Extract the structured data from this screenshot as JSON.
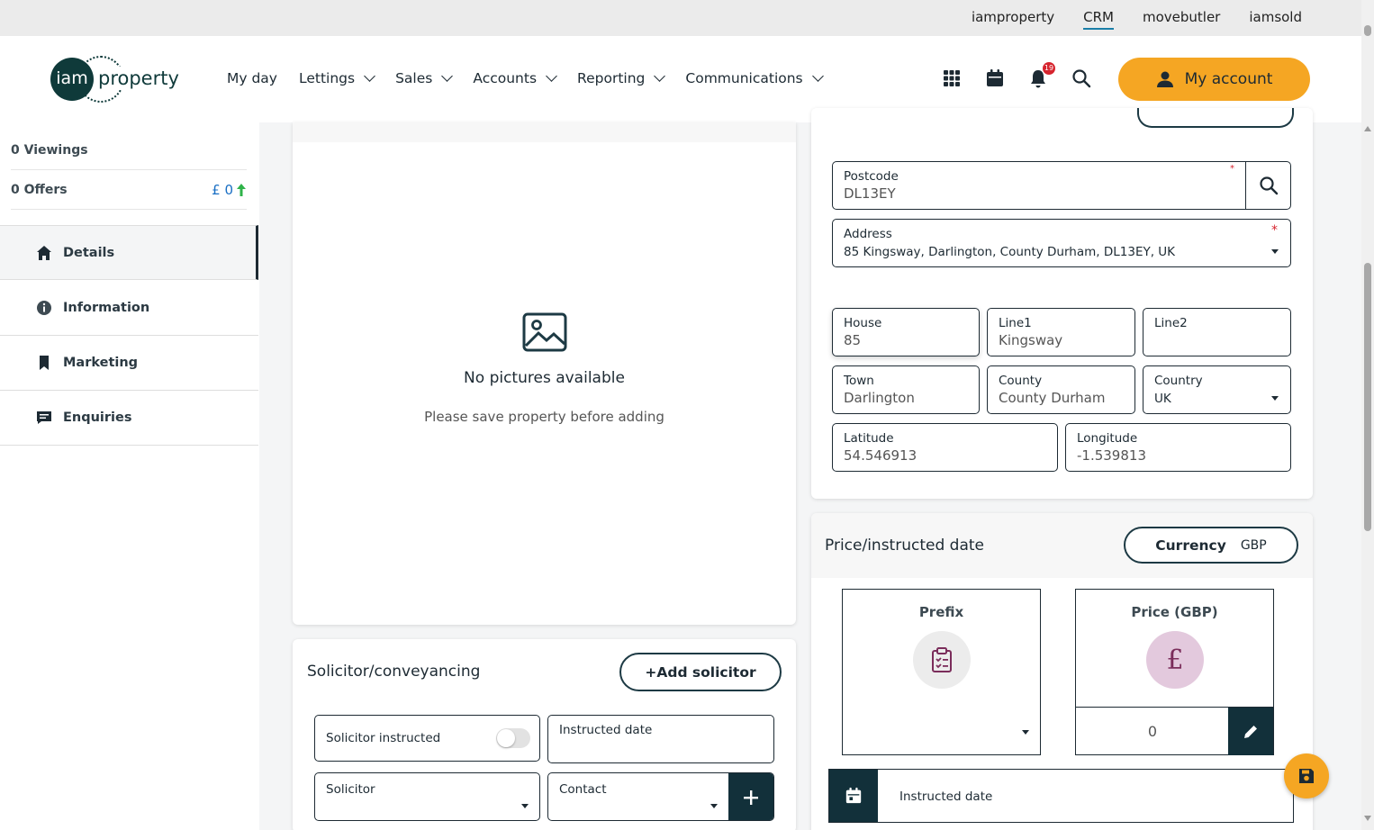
{
  "top_links": [
    {
      "label": "iamproperty",
      "active": false
    },
    {
      "label": "CRM",
      "active": true
    },
    {
      "label": "movebutler",
      "active": false
    },
    {
      "label": "iamsold",
      "active": false
    }
  ],
  "logo": {
    "circle_text": "iam",
    "word": "property"
  },
  "nav": [
    {
      "label": "My day",
      "dropdown": false
    },
    {
      "label": "Lettings",
      "dropdown": true
    },
    {
      "label": "Sales",
      "dropdown": true
    },
    {
      "label": "Accounts",
      "dropdown": true
    },
    {
      "label": "Reporting",
      "dropdown": true
    },
    {
      "label": "Communications",
      "dropdown": true
    }
  ],
  "header_icons": {
    "notifications_count": "19"
  },
  "account_button": {
    "label": "My account"
  },
  "sidebar": {
    "viewings": "0 Viewings",
    "offers": "0 Offers",
    "offers_value": "£ 0",
    "items": [
      {
        "label": "Details",
        "icon": "home-icon",
        "active": true
      },
      {
        "label": "Information",
        "icon": "info-icon",
        "active": false
      },
      {
        "label": "Marketing",
        "icon": "bookmark-icon",
        "active": false
      },
      {
        "label": "Enquiries",
        "icon": "chat-icon",
        "active": false
      }
    ]
  },
  "pictures": {
    "empty_title": "No pictures available",
    "empty_subtitle": "Please save property before adding"
  },
  "solicitor": {
    "title": "Solicitor/conveyancing",
    "add_button": "+Add solicitor",
    "instructed_toggle_label": "Solicitor instructed",
    "instructed_date_label": "Instructed date",
    "solicitor_label": "Solicitor",
    "contact_label": "Contact"
  },
  "address": {
    "postcode_label": "Postcode",
    "postcode_value": "DL13EY",
    "address_label": "Address",
    "address_value": "85 Kingsway, Darlington, County Durham, DL13EY, UK",
    "house_label": "House",
    "house_value": "85",
    "line1_label": "Line1",
    "line1_value": "Kingsway",
    "line2_label": "Line2",
    "line2_value": "",
    "town_label": "Town",
    "town_value": "Darlington",
    "county_label": "County",
    "county_value": "County Durham",
    "country_label": "Country",
    "country_value": "UK",
    "latitude_label": "Latitude",
    "latitude_value": "54.546913",
    "longitude_label": "Longitude",
    "longitude_value": "-1.539813"
  },
  "price": {
    "title": "Price/instructed date",
    "currency_label": "Currency",
    "currency_value": "GBP",
    "prefix_label": "Prefix",
    "price_label": "Price (GBP)",
    "price_symbol": "£",
    "price_value": "0",
    "instructed_date_label": "Instructed date"
  },
  "colors": {
    "accent": "#f5a623",
    "dark": "#0f3a3a",
    "badge": "#d6242e",
    "link": "#1a6fc4"
  }
}
